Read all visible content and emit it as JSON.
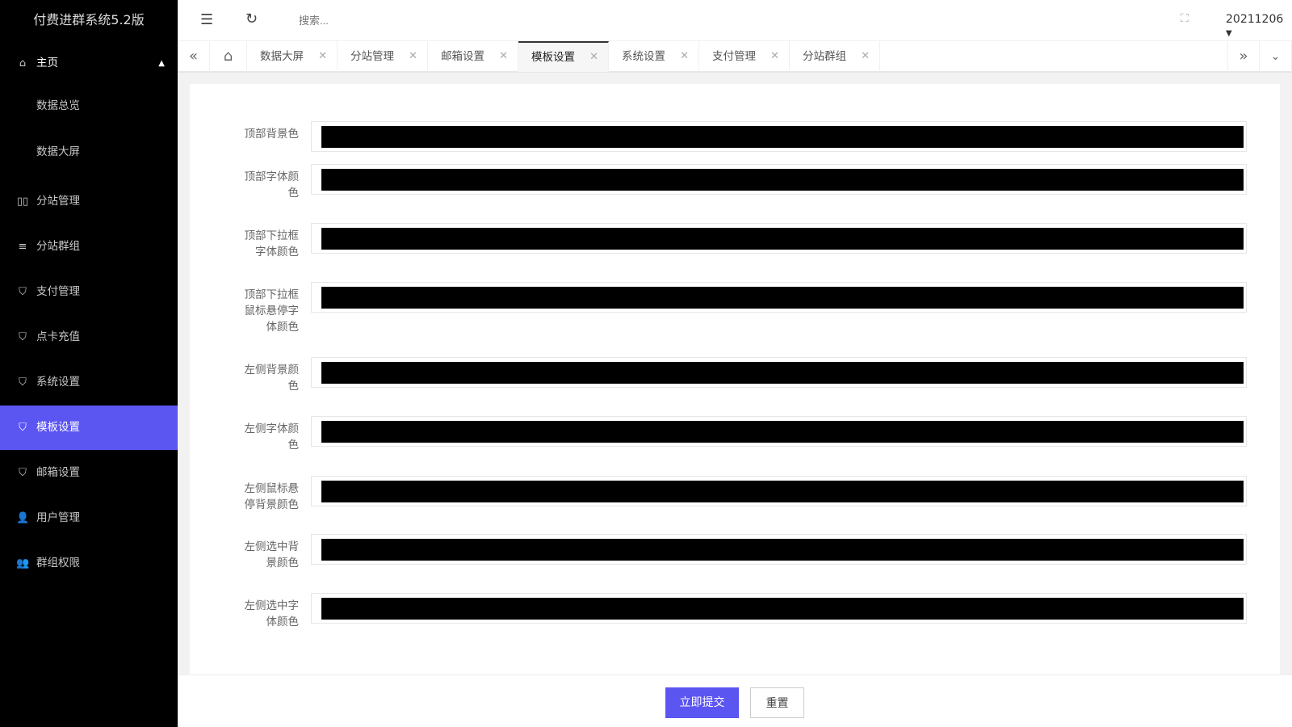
{
  "app": {
    "title": "付费进群系统5.2版"
  },
  "sidebar": {
    "items": [
      {
        "label": "主页",
        "icon": "home-icon"
      },
      {
        "label": "数据总览"
      },
      {
        "label": "数据大屏"
      },
      {
        "label": "分站管理",
        "icon": "columns-icon"
      },
      {
        "label": "分站群组",
        "icon": "sliders-icon"
      },
      {
        "label": "支付管理",
        "icon": "shield-check-icon"
      },
      {
        "label": "点卡充值",
        "icon": "shield-check-icon"
      },
      {
        "label": "系统设置",
        "icon": "shield-check-icon"
      },
      {
        "label": "模板设置",
        "icon": "shield-check-icon",
        "active": true
      },
      {
        "label": "邮箱设置",
        "icon": "shield-check-icon"
      },
      {
        "label": "用户管理",
        "icon": "user-icon"
      },
      {
        "label": "群组权限",
        "icon": "users-icon"
      }
    ]
  },
  "header": {
    "search_placeholder": "搜索...",
    "user": "20211206"
  },
  "tabs": [
    {
      "label": "数据大屏"
    },
    {
      "label": "分站管理"
    },
    {
      "label": "邮箱设置"
    },
    {
      "label": "模板设置",
      "active": true
    },
    {
      "label": "系统设置"
    },
    {
      "label": "支付管理"
    },
    {
      "label": "分站群组"
    }
  ],
  "form": {
    "fields": [
      {
        "label": "顶部背景色",
        "value": "#000000"
      },
      {
        "label": "顶部字体颜色",
        "value": "#000000"
      },
      {
        "label": "顶部下拉框字体颜色",
        "value": "#000000"
      },
      {
        "label": "顶部下拉框鼠标悬停字体颜色",
        "value": "#000000"
      },
      {
        "label": "左侧背景颜色",
        "value": "#000000"
      },
      {
        "label": "左侧字体颜色",
        "value": "#000000"
      },
      {
        "label": "左侧鼠标悬停背景颜色",
        "value": "#000000"
      },
      {
        "label": "左侧选中背景颜色",
        "value": "#000000"
      },
      {
        "label": "左侧选中字体颜色",
        "value": "#000000"
      }
    ]
  },
  "buttons": {
    "submit": "立即提交",
    "reset": "重置"
  },
  "colors": {
    "accent": "#5b55f2",
    "sidebar_bg": "#000000"
  }
}
